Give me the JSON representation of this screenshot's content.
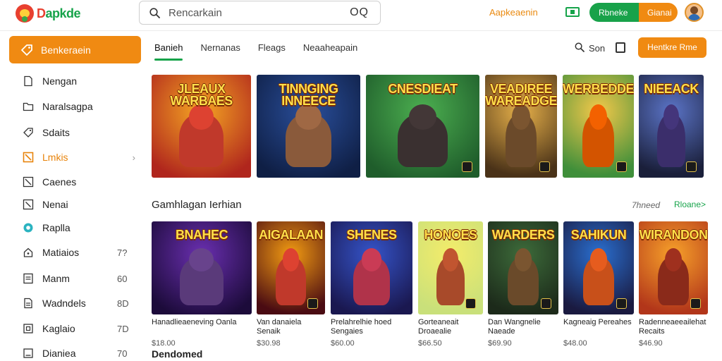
{
  "header": {
    "logo_text_d": "D",
    "logo_text_rest": "apkde",
    "search_placeholder": "Rencarkain",
    "search_trailing": "OQ",
    "link_label": "Aapkeaenin",
    "pill_green_label": "Rbneke",
    "pill_orange_label": "Gianai"
  },
  "sidebar": {
    "primary_label": "Benkeraein",
    "items": [
      {
        "label": "Nengan",
        "count": "",
        "icon": "file-icon"
      },
      {
        "label": "Naralsagpa",
        "count": "",
        "icon": "folder-icon"
      },
      {
        "label": "Sdaits",
        "count": "",
        "icon": "tag-icon"
      },
      {
        "label": "Lmkis",
        "count": "",
        "icon": "bookmark-icon",
        "active": true
      },
      {
        "label": "Caenes",
        "count": "",
        "icon": "image-icon"
      },
      {
        "label": "Nenai",
        "count": "",
        "icon": "frame-icon"
      },
      {
        "label": "Raplla",
        "count": "",
        "icon": "circle-icon"
      },
      {
        "label": "Matiaios",
        "count": "7?",
        "icon": "home-icon"
      },
      {
        "label": "Manm",
        "count": "60",
        "icon": "list-icon"
      },
      {
        "label": "Wadndels",
        "count": "8D",
        "icon": "document-icon"
      },
      {
        "label": "Kaglaio",
        "count": "7D",
        "icon": "box-icon"
      },
      {
        "label": "Dianiea",
        "count": "70",
        "icon": "panel-icon"
      }
    ]
  },
  "tabs": [
    {
      "label": "Banieh",
      "active": true
    },
    {
      "label": "Nernanas",
      "active": false
    },
    {
      "label": "Fleags",
      "active": false
    },
    {
      "label": "Neaaheapain",
      "active": false
    }
  ],
  "toolbar": {
    "search_label": "Son",
    "button_label": "Hentkre Rme"
  },
  "featured": [
    {
      "title": "JLEAUX WARBAES",
      "c1": "#f5a623",
      "c2": "#b0261d",
      "hero": "#c0392b"
    },
    {
      "title": "TINNGING INNEECE",
      "c1": "#2a4f9c",
      "c2": "#0f1f45",
      "hero": "#8a5a3b"
    },
    {
      "title": "CNESDIEAT",
      "c1": "#4caf50",
      "c2": "#1f5d2b",
      "hero": "#3a3030"
    },
    {
      "title": "VEADIREE WAREADGE",
      "c1": "#e7b14a",
      "c2": "#4a3218",
      "hero": "#6b4a2a"
    },
    {
      "title": "WERBEDDEE",
      "c1": "#f4c84a",
      "c2": "#3f8f3a",
      "hero": "#d35400"
    },
    {
      "title": "NIEEACK",
      "c1": "#5b74c7",
      "c2": "#1a1f3a",
      "hero": "#3b2e6b"
    }
  ],
  "section": {
    "title": "Gamhlagan Ierhian",
    "meta": "7hneed",
    "more": "Rloane>"
  },
  "games": [
    {
      "title": "BNAHEC",
      "name": "Hanadlieaeneving Oanla",
      "price": "$18.00",
      "c1": "#6a2fb0",
      "c2": "#1c0b3a",
      "hero": "#5a3a7a"
    },
    {
      "title": "AIGALAAN",
      "name": "Van danaiela Senaik",
      "price": "$30.98",
      "c1": "#f39c12",
      "c2": "#4a0b12",
      "hero": "#c0392b"
    },
    {
      "title": "SHENES",
      "name": "Prelahrelhie hoed Sengaies",
      "price": "$60.00",
      "c1": "#3554c9",
      "c2": "#1a1850",
      "hero": "#b0334a"
    },
    {
      "title": "HONOES",
      "name": "Gorteaneait Droaealie",
      "price": "$66.50",
      "c1": "#f4ec6a",
      "c2": "#c9e07a",
      "hero": "#a84a2a"
    },
    {
      "title": "WARDERS",
      "name": "Dan Wangnelie Naeade",
      "price": "$69.90",
      "c1": "#3d6b3a",
      "c2": "#1c2a1a",
      "hero": "#6a4a2a"
    },
    {
      "title": "SAHIKUN",
      "name": "Kagneaig Pereahes",
      "price": "$48.00",
      "c1": "#2a6fd0",
      "c2": "#1a1a40",
      "hero": "#c8501a"
    },
    {
      "title": "WIRANDON",
      "name": "Radenneaeeailehat Recaits",
      "price": "$46.90",
      "c1": "#f7a12a",
      "c2": "#b2361a",
      "hero": "#8a2a1a"
    }
  ],
  "bottom": {
    "title": "Dendomed"
  },
  "colors": {
    "accent_orange": "#f08a12",
    "accent_green": "#16a34a"
  }
}
